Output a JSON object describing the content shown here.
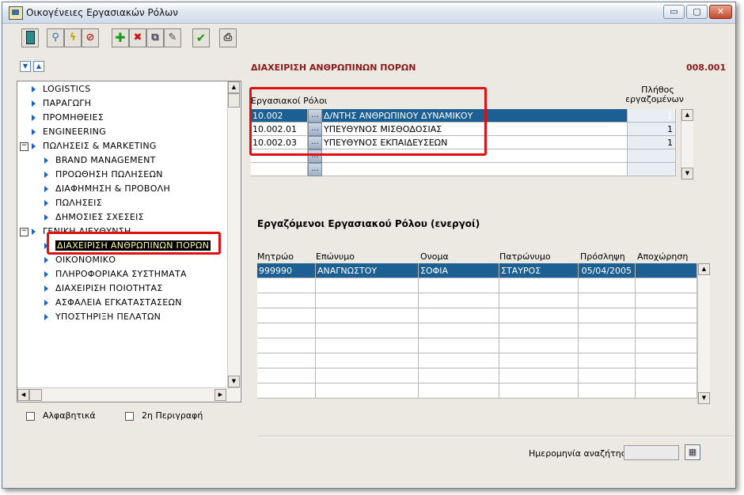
{
  "window": {
    "title": "Οικογένειες Εργασιακών Ρόλων",
    "controls": {
      "minimize": "▭",
      "maximize": "▢",
      "close": "✕"
    }
  },
  "toolbar": {
    "icons": [
      "exit-icon",
      "search-icon",
      "flash-icon",
      "cancel-icon",
      "add-icon",
      "delete-icon",
      "copy-icon",
      "edit-icon",
      "confirm-icon",
      "print-icon"
    ]
  },
  "tree": {
    "items": [
      {
        "label": "LOGISTICS",
        "level": 0,
        "expander": ""
      },
      {
        "label": "ΠΑΡΑΓΩΓΗ",
        "level": 0,
        "expander": ""
      },
      {
        "label": "ΠΡΟΜΗΘΕΙΕΣ",
        "level": 0,
        "expander": ""
      },
      {
        "label": "ENGINEERING",
        "level": 0,
        "expander": ""
      },
      {
        "label": "ΠΩΛΗΣΕΙΣ & MARKETING",
        "level": 0,
        "expander": "−"
      },
      {
        "label": "BRAND MANAGEMENT",
        "level": 1,
        "expander": ""
      },
      {
        "label": "ΠΡΟΩΘΗΣΗ ΠΩΛΗΣΕΩΝ",
        "level": 1,
        "expander": ""
      },
      {
        "label": "ΔΙΑΦΗΜΗΣΗ & ΠΡΟΒΟΛΗ",
        "level": 1,
        "expander": ""
      },
      {
        "label": "ΠΩΛΗΣΕΙΣ",
        "level": 1,
        "expander": ""
      },
      {
        "label": "ΔΗΜΟΣΙΕΣ ΣΧΕΣΕΙΣ",
        "level": 1,
        "expander": ""
      },
      {
        "label": "ΓΕΝΙΚΗ ΔΙΕΥΘΥΝΣΗ",
        "level": 0,
        "expander": "−"
      },
      {
        "label": "ΔΙΑΧΕΙΡΙΣΗ ΑΝΘΡΩΠΙΝΩΝ ΠΟΡΩΝ",
        "level": 1,
        "expander": "",
        "selected": true
      },
      {
        "label": "ΟΙΚΟΝΟΜΙΚΟ",
        "level": 1,
        "expander": ""
      },
      {
        "label": "ΠΛΗΡΟΦΟΡΙΑΚΑ ΣΥΣΤΗΜΑΤΑ",
        "level": 1,
        "expander": ""
      },
      {
        "label": "ΔΙΑΧΕΙΡΙΣΗ ΠΟΙΟΤΗΤΑΣ",
        "level": 1,
        "expander": ""
      },
      {
        "label": "ΑΣΦΑΛΕΙΑ ΕΓΚΑΤΑΣΤΑΣΕΩΝ",
        "level": 1,
        "expander": ""
      },
      {
        "label": "ΥΠΟΣΤΗΡΙΞΗ ΠΕΛΑΤΩΝ",
        "level": 1,
        "expander": ""
      }
    ]
  },
  "options": {
    "alphabetical": {
      "label": "Αλφαβητικά",
      "checked": false
    },
    "second_desc": {
      "label": "2η Περιγραφή",
      "checked": false
    }
  },
  "header": {
    "section_title": "ΔΙΑΧΕΙΡΙΣΗ ΑΝΘΡΩΠΙΝΩΝ ΠΟΡΩΝ",
    "code": "008.001"
  },
  "roles": {
    "label": "Εργασιακοί Ρόλοι",
    "count_header_line1": "Πλήθος",
    "count_header_line2": "εργαζομένων",
    "button_glyph": "...",
    "rows": [
      {
        "code": "10.002",
        "description": "Δ/ΝΤΗΣ ΑΝΘΡΩΠΙΝΟΥ ΔΥΝΑΜΙΚΟΥ",
        "count": "1",
        "selected": true
      },
      {
        "code": "10.002.01",
        "description": "ΥΠΕΥΘΥΝΟΣ ΜΙΣΘΟΔΟΣΙΑΣ",
        "count": "1"
      },
      {
        "code": "10.002.03",
        "description": "ΥΠΕΥΘΥΝΟΣ ΕΚΠΑΙΔΕΥΣΕΩΝ",
        "count": "1"
      },
      {
        "code": "",
        "description": "",
        "count": ""
      },
      {
        "code": "",
        "description": "",
        "count": ""
      }
    ]
  },
  "employees": {
    "title": "Εργαζόμενοι Εργασιακού Ρόλου (ενεργοί)",
    "columns": [
      "Μητρώο",
      "Επώνυμο",
      "Ονομα",
      "Πατρώνυμο",
      "Πρόσληψη",
      "Αποχώρηση"
    ],
    "rows": [
      [
        "999990",
        "ΑΝΑΓΝΩΣΤΟΥ",
        "ΣΟΦΙΑ",
        "ΣΤΑΥΡΟΣ",
        "05/04/2005",
        ""
      ],
      [
        "",
        "",
        "",
        "",
        "",
        ""
      ],
      [
        "",
        "",
        "",
        "",
        "",
        ""
      ],
      [
        "",
        "",
        "",
        "",
        "",
        ""
      ],
      [
        "",
        "",
        "",
        "",
        "",
        ""
      ],
      [
        "",
        "",
        "",
        "",
        "",
        ""
      ],
      [
        "",
        "",
        "",
        "",
        "",
        ""
      ],
      [
        "",
        "",
        "",
        "",
        "",
        ""
      ],
      [
        "",
        "",
        "",
        "",
        "",
        ""
      ]
    ]
  },
  "search_date": {
    "label": "Ημερομηνία αναζήτησης",
    "value": ""
  }
}
